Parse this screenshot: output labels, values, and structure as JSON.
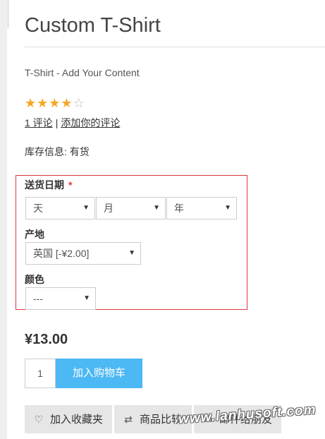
{
  "product": {
    "title": "Custom T-Shirt",
    "description": "T-Shirt - Add Your Content",
    "rating": 4,
    "rating_max": 5,
    "reviews_link": "1 评论",
    "reviews_sep": "|",
    "add_review_link": "添加你的评论",
    "stock_label": "库存信息:",
    "stock_value": "有货",
    "price": "¥13.00"
  },
  "options": {
    "delivery_date": {
      "label": "送货日期",
      "required_mark": "*",
      "day": "天",
      "month": "月",
      "year": "年"
    },
    "origin": {
      "label": "产地",
      "value": "英国 [-¥2.00]"
    },
    "color": {
      "label": "颜色",
      "value": "---"
    }
  },
  "cart": {
    "quantity": "1",
    "add_to_cart": "加入购物车"
  },
  "actions": {
    "wishlist": "加入收藏夹",
    "compare": "商品比较",
    "email": "邮件给朋友"
  },
  "watermark": "www.lanhusoft.com",
  "colors": {
    "accent": "#4cb8f4",
    "star": "#f5a623",
    "required": "#e4393c",
    "highlight_border": "#d9363e"
  }
}
